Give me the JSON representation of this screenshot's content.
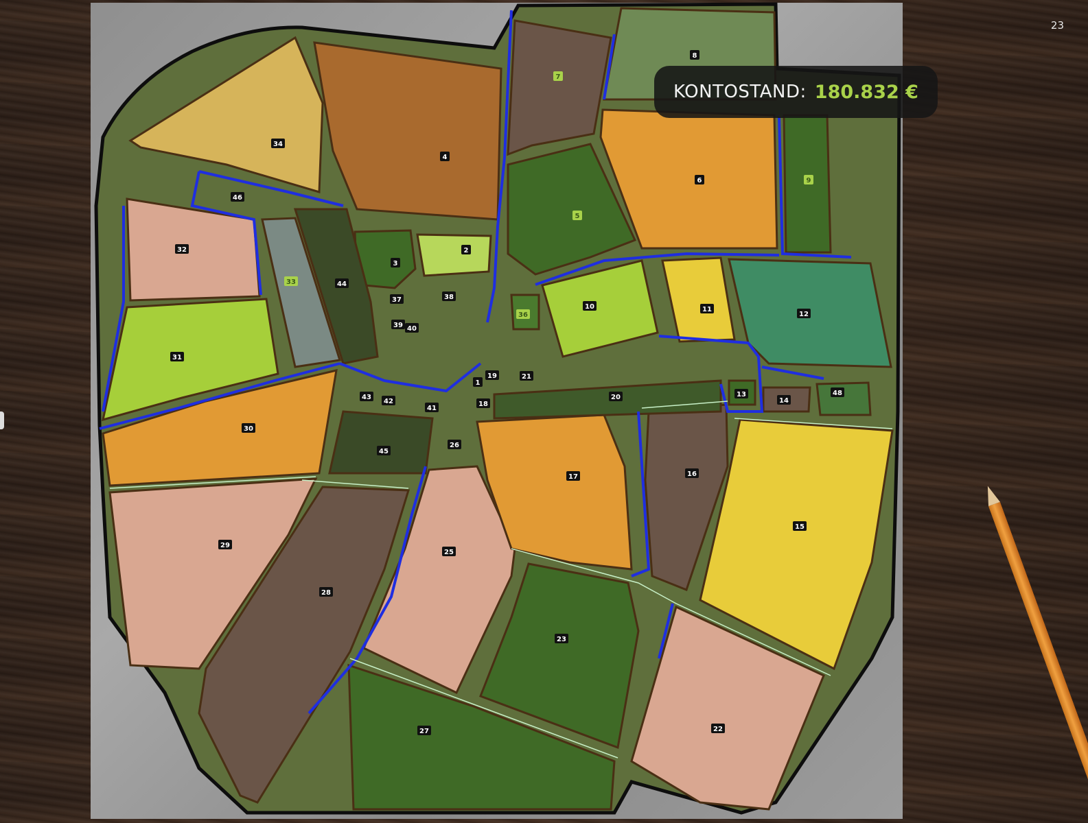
{
  "page_number": "23",
  "balance": {
    "label": "KONTOSTAND:",
    "value": "180.832 €"
  },
  "colors": {
    "accent_green": "#a9d24a",
    "sand": "#d6b45a",
    "brown": "#a96a2e",
    "dark_brown": "#6a5548",
    "dark_green": "#3f6a26",
    "light_green": "#a6cf3a",
    "pale_green": "#b7d75b",
    "orange": "#e19a34",
    "pink": "#d9a791",
    "yellow": "#e8cc3a",
    "teal": "#3f8c64",
    "slate": "#7b8a84",
    "road": "#1f2ee0"
  },
  "fields": [
    {
      "id": "2",
      "color": "pale_green"
    },
    {
      "id": "3",
      "color": "dark_green"
    },
    {
      "id": "4",
      "color": "brown"
    },
    {
      "id": "5",
      "color": "dark_green"
    },
    {
      "id": "6",
      "color": "orange"
    },
    {
      "id": "7",
      "color": "dark_brown"
    },
    {
      "id": "8",
      "color": "dark_green"
    },
    {
      "id": "9",
      "color": "dark_green"
    },
    {
      "id": "10",
      "color": "light_green"
    },
    {
      "id": "11",
      "color": "yellow"
    },
    {
      "id": "12",
      "color": "teal"
    },
    {
      "id": "13",
      "color": "dark_green"
    },
    {
      "id": "14",
      "color": "dark_brown"
    },
    {
      "id": "15",
      "color": "yellow"
    },
    {
      "id": "16",
      "color": "dark_brown"
    },
    {
      "id": "17",
      "color": "orange"
    },
    {
      "id": "18",
      "color": "dark_green"
    },
    {
      "id": "19",
      "color": "dark_green"
    },
    {
      "id": "20",
      "color": "dark_green"
    },
    {
      "id": "21",
      "color": "dark_green"
    },
    {
      "id": "22",
      "color": "pink"
    },
    {
      "id": "23",
      "color": "dark_green"
    },
    {
      "id": "25",
      "color": "pink"
    },
    {
      "id": "26",
      "color": "dark_green"
    },
    {
      "id": "27",
      "color": "dark_green"
    },
    {
      "id": "28",
      "color": "dark_brown"
    },
    {
      "id": "29",
      "color": "pink"
    },
    {
      "id": "30",
      "color": "orange"
    },
    {
      "id": "31",
      "color": "light_green"
    },
    {
      "id": "32",
      "color": "pink"
    },
    {
      "id": "33",
      "color": "slate"
    },
    {
      "id": "34",
      "color": "sand"
    },
    {
      "id": "36",
      "color": "dark_green"
    },
    {
      "id": "37",
      "color": "dark_green"
    },
    {
      "id": "38",
      "color": "dark_green"
    },
    {
      "id": "39",
      "color": "dark_green"
    },
    {
      "id": "40",
      "color": "dark_green"
    },
    {
      "id": "41",
      "color": "dark_green"
    },
    {
      "id": "42",
      "color": "dark_green"
    },
    {
      "id": "43",
      "color": "dark_green"
    },
    {
      "id": "44",
      "color": "dark_green"
    },
    {
      "id": "45",
      "color": "dark_green"
    },
    {
      "id": "46",
      "color": "dark_green"
    },
    {
      "id": "48",
      "color": "dark_green"
    },
    {
      "id": "1",
      "color": "dark_green"
    }
  ]
}
